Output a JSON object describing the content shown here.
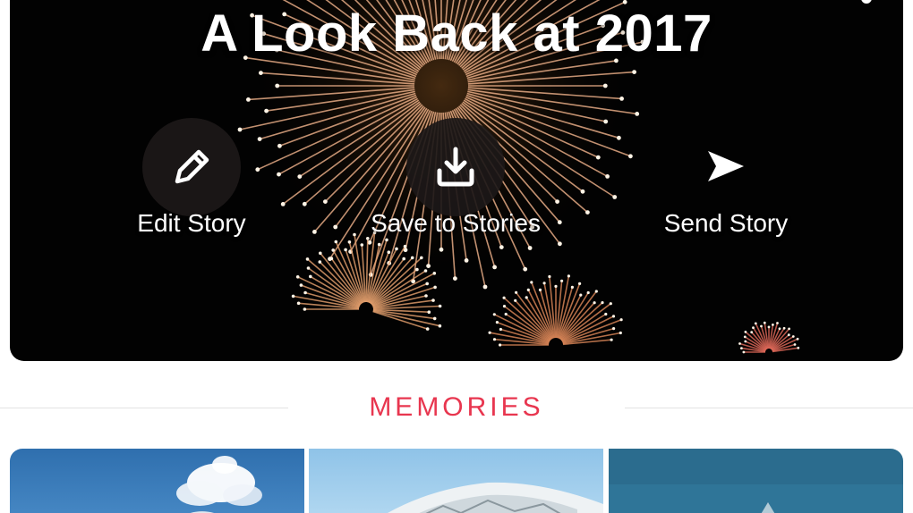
{
  "story": {
    "title": "A Look Back at 2017",
    "actions": [
      {
        "label": "Edit Story",
        "icon": "pencil-icon"
      },
      {
        "label": "Save to Stories",
        "icon": "download-icon"
      },
      {
        "label": "Send Story",
        "icon": "send-arrow-icon"
      }
    ]
  },
  "memories": {
    "section_title": "MEMORIES",
    "tiles": [
      {
        "scene": "blue sky with cloud"
      },
      {
        "scene": "snowy mountain peak"
      },
      {
        "scene": "teal sky"
      }
    ]
  },
  "colors": {
    "accent": "#E8364F",
    "hero_background": "#020202",
    "firework": "#F2B48C"
  }
}
